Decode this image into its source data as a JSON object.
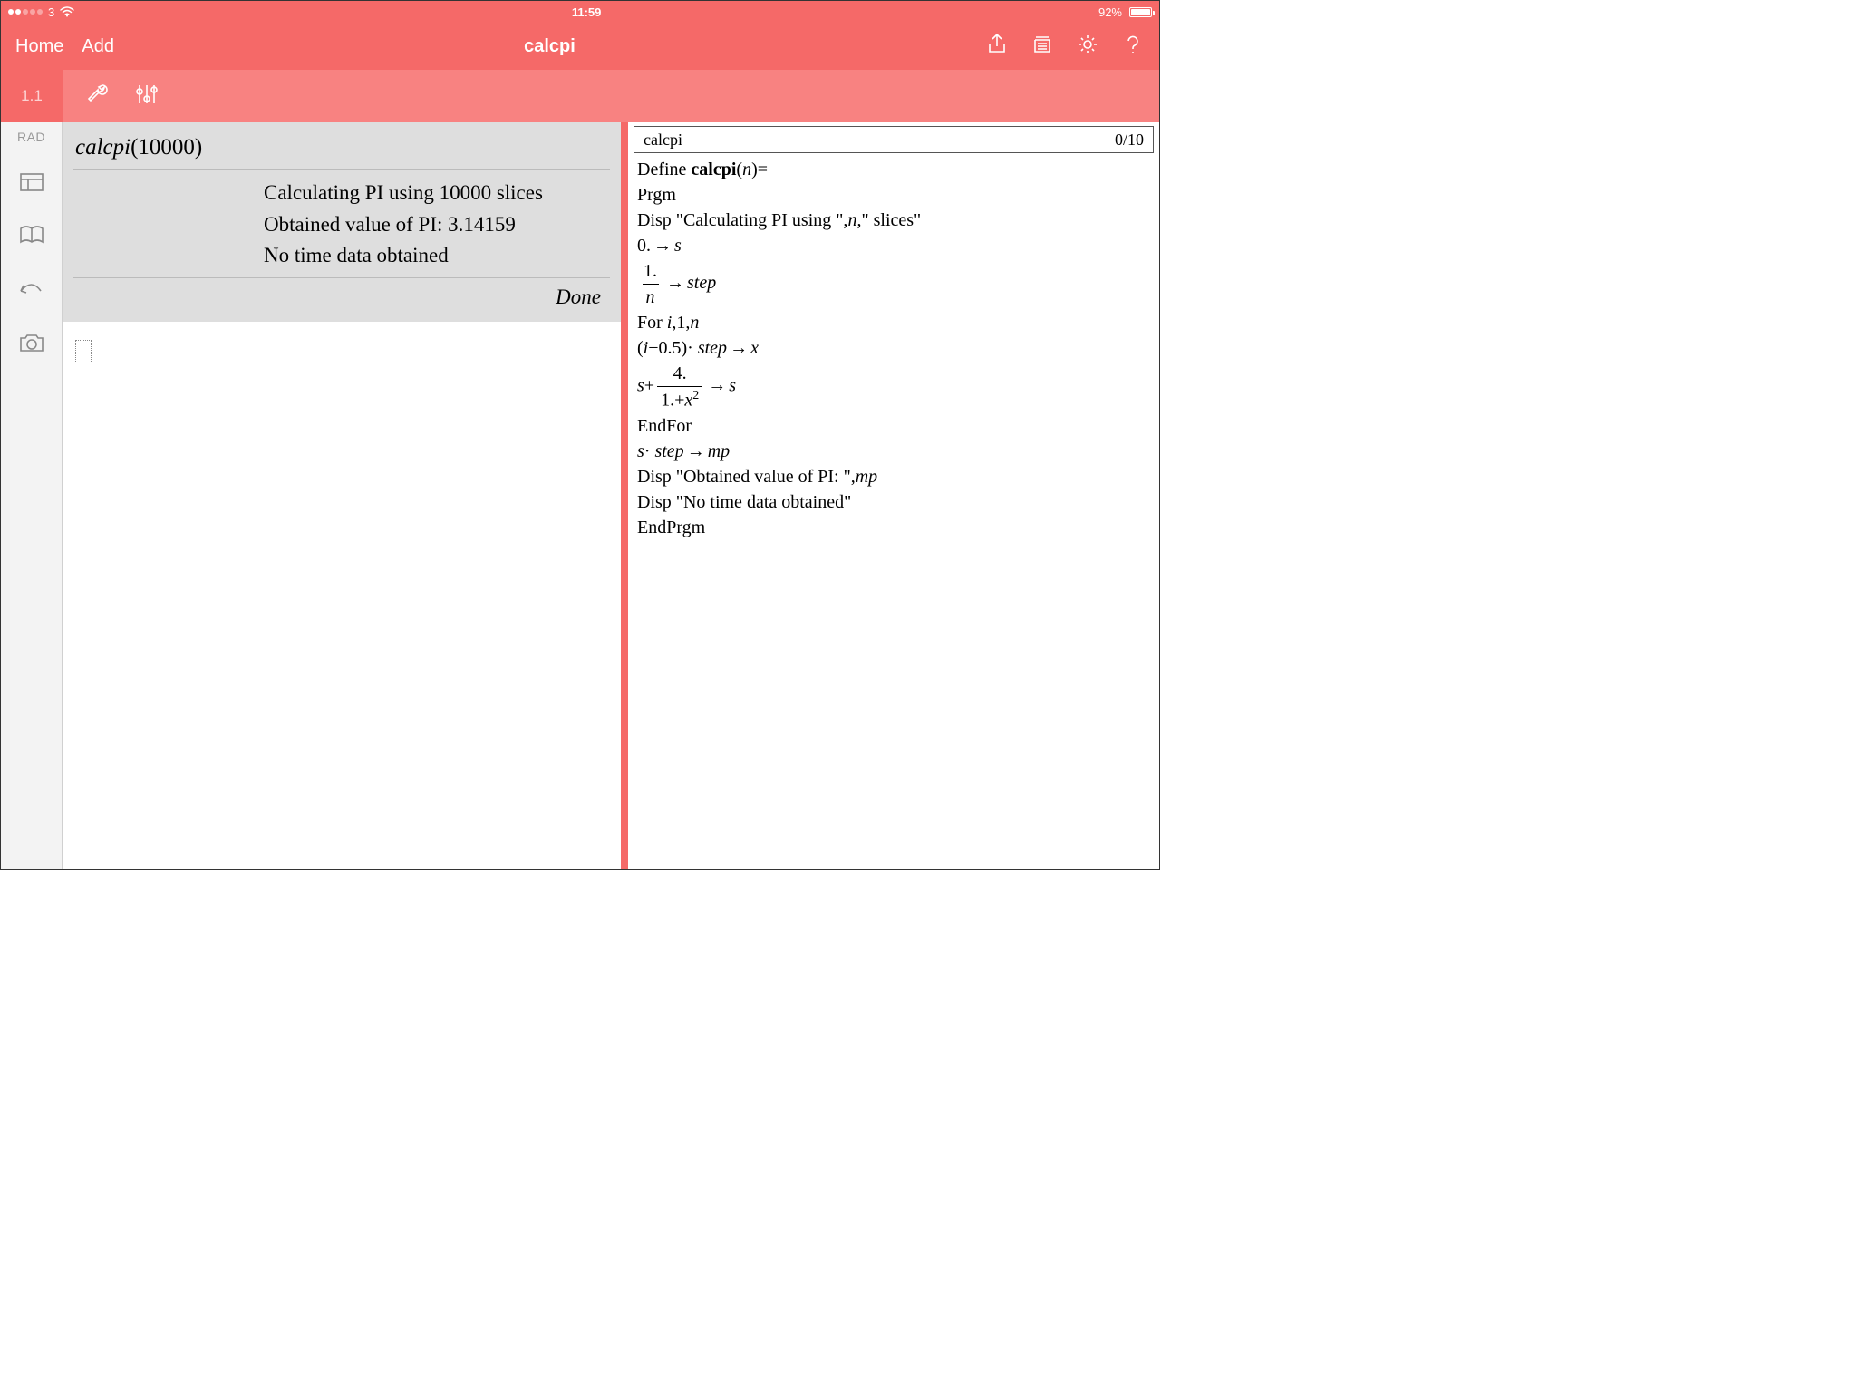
{
  "statusbar": {
    "carrier": "3",
    "time": "11:59",
    "battery_pct": "92%"
  },
  "nav": {
    "home": "Home",
    "add": "Add",
    "title": "calcpi"
  },
  "toolbar": {
    "tab": "1.1"
  },
  "sidebar": {
    "rad": "RAD"
  },
  "calc": {
    "input_fn": "calcpi",
    "input_arg": "10000",
    "out1": "Calculating PI using  10000  slices",
    "out2": "Obtained value of PI:  3.14159",
    "out3": "No time data obtained",
    "done": "Done"
  },
  "code": {
    "header_name": "calcpi",
    "header_pos": "0/10",
    "l_define_a": "Define ",
    "l_define_b": "calcpi",
    "l_define_c": "(",
    "l_define_d": "n",
    "l_define_e": ")=",
    "l_prgm": "Prgm",
    "l_disp1_a": "Disp \"Calculating PI using \",",
    "l_disp1_b": "n",
    "l_disp1_c": ",\" slices\"",
    "l_zero_s_a": "0.",
    "l_zero_s_b": "s",
    "l_step_num": "1.",
    "l_step_den": "n",
    "l_step_rhs": "step",
    "l_for_a": "For ",
    "l_for_b": "i",
    "l_for_c": ",1,",
    "l_for_d": "n",
    "l_x_a": "(",
    "l_x_b": "i",
    "l_x_c": "−0.5)·",
    "l_x_d": " step",
    "l_x_e": "x",
    "l_s_lhs": "s",
    "l_s_plus": "+",
    "l_s_num": "4.",
    "l_s_den_a": "1.+",
    "l_s_den_b": "x",
    "l_s_den_c": "2",
    "l_s_rhs": "s",
    "l_endfor": "EndFor",
    "l_mp_a": "s",
    "l_mp_b": "·",
    "l_mp_c": " step",
    "l_mp_d": "mp",
    "l_disp2_a": "Disp \"Obtained value of PI: \",",
    "l_disp2_b": "mp",
    "l_disp3": "Disp \"No time data obtained\"",
    "l_endprgm": "EndPrgm"
  }
}
